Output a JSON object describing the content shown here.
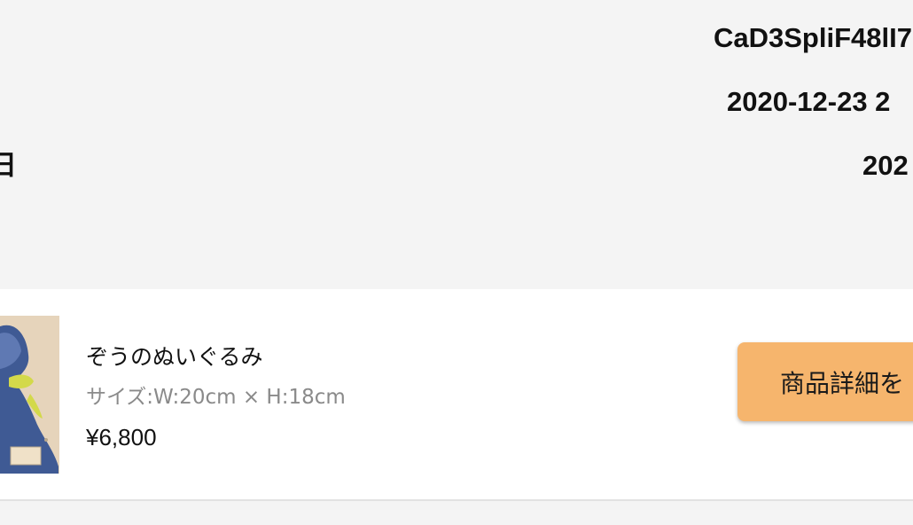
{
  "order_info": {
    "order_id": "CaD3SpliF48lI7",
    "order_date": "2020-12-23 2",
    "extra_date": "202",
    "left_label_fragment": "日"
  },
  "product": {
    "name": "ぞうのぬいぐるみ",
    "size": "サイズ:W:20cm × H:18cm",
    "price": "¥6,800",
    "image_icon": "plush-toy-photo",
    "detail_button_label": "商品詳細を"
  },
  "colors": {
    "page_background": "#f4f4f4",
    "card_background": "#ffffff",
    "button_background": "#f6b56d",
    "secondary_text": "#8a8a8a"
  }
}
